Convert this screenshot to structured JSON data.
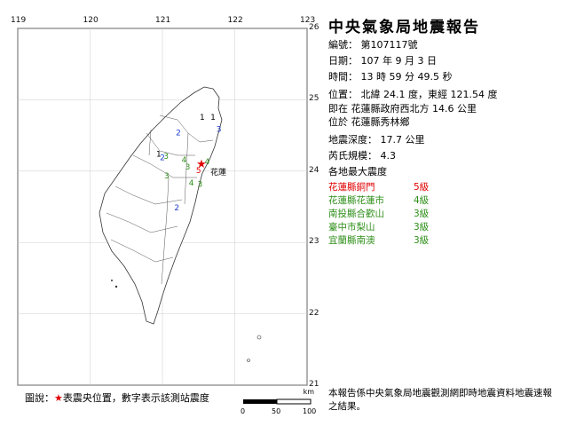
{
  "report": {
    "title": "中央氣象局地震報告",
    "number": "編號： 第107117號",
    "date": "日期： 107 年 9 月 3 日",
    "time": "時間： 13 時 59 分 49.5 秒",
    "position": "位置： 北緯 24.1 度，東經 121.54 度",
    "relative_to": "即在 花蓮縣政府西北方 14.6 公里",
    "located_in": "位於 花蓮縣秀林鄉",
    "depth": "地震深度： 17.7 公里",
    "magnitude": "芮氏規模： 4.3",
    "max_intensity_heading": "各地最大震度",
    "stations": [
      {
        "name": "花蓮縣銅門",
        "level": "5級",
        "color": "#e00000"
      },
      {
        "name": "花蓮縣花蓮市",
        "level": "4級",
        "color": "#2f8f1a"
      },
      {
        "name": "南投縣合歡山",
        "level": "3級",
        "color": "#2f8f1a"
      },
      {
        "name": "臺中市梨山",
        "level": "3級",
        "color": "#2f8f1a"
      },
      {
        "name": "宜蘭縣南澳",
        "level": "3級",
        "color": "#2f8f1a"
      }
    ],
    "footnote": "本報告係中央氣象局地震觀測網即時地震資料地震速報之結果。"
  },
  "map": {
    "lon_ticks": [
      "119",
      "120",
      "121",
      "122",
      "123"
    ],
    "lat_ticks": [
      "26",
      "25",
      "24",
      "23",
      "22",
      "21"
    ],
    "city_label": "花蓮",
    "epicenter": {
      "lon": 121.54,
      "lat": 24.1
    },
    "intensity_marks": [
      {
        "text": "1",
        "lon": 121.55,
        "lat": 24.72,
        "color": "#000000"
      },
      {
        "text": "1",
        "lon": 121.7,
        "lat": 24.72,
        "color": "#000000"
      },
      {
        "text": "1",
        "lon": 120.95,
        "lat": 24.2,
        "color": "#000000"
      },
      {
        "text": "2",
        "lon": 121.22,
        "lat": 24.5,
        "color": "#1e3fcf"
      },
      {
        "text": "2",
        "lon": 121.0,
        "lat": 24.15,
        "color": "#1e3fcf"
      },
      {
        "text": "2",
        "lon": 121.2,
        "lat": 23.45,
        "color": "#1e3fcf"
      },
      {
        "text": "3",
        "lon": 121.05,
        "lat": 24.17,
        "color": "#2f8f1a"
      },
      {
        "text": "3",
        "lon": 121.78,
        "lat": 24.55,
        "color": "#1e3fcf"
      },
      {
        "text": "3",
        "lon": 121.06,
        "lat": 23.9,
        "color": "#2f8f1a"
      },
      {
        "text": "3",
        "lon": 121.52,
        "lat": 23.78,
        "color": "#2f8f1a"
      },
      {
        "text": "4",
        "lon": 121.3,
        "lat": 24.12,
        "color": "#2f8f1a"
      },
      {
        "text": "4",
        "lon": 121.62,
        "lat": 24.1,
        "color": "#2f8f1a"
      },
      {
        "text": "4",
        "lon": 121.4,
        "lat": 23.8,
        "color": "#2f8f1a"
      },
      {
        "text": "5",
        "lon": 121.5,
        "lat": 23.97,
        "color": "#e00000"
      },
      {
        "text": "3",
        "lon": 121.35,
        "lat": 24.02,
        "color": "#2f8f1a"
      }
    ],
    "legend_prefix": "圖說：",
    "legend_star": "★",
    "legend_suffix": "表震央位置，數字表示該測站震度",
    "scale_unit": "km",
    "scale_ticks": [
      "0",
      "50",
      "100"
    ]
  }
}
